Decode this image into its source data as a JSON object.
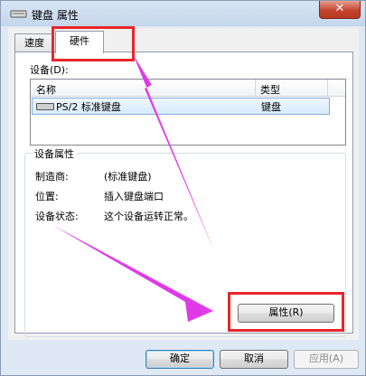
{
  "window": {
    "title": "键盘 属性",
    "close_glyph": "✕"
  },
  "tabs": [
    {
      "label": "速度"
    },
    {
      "label": "硬件"
    }
  ],
  "devices": {
    "label": "设备(D):",
    "columns": {
      "name": "名称",
      "type": "类型"
    },
    "rows": [
      {
        "name": "PS/2 标准键盘",
        "type": "键盘"
      }
    ]
  },
  "device_properties": {
    "title": "设备属性",
    "manufacturer_label": "制造商:",
    "manufacturer_value": "(标准键盘)",
    "location_label": "位置:",
    "location_value": "插入键盘端口",
    "status_label": "设备状态:",
    "status_value": "这个设备运转正常。",
    "properties_button": "属性(R)"
  },
  "footer": {
    "ok": "确定",
    "cancel": "取消",
    "apply": "应用(A)"
  },
  "annotations": {
    "highlight_color": "#e8262a",
    "arrow_color": "#e03ae8"
  }
}
